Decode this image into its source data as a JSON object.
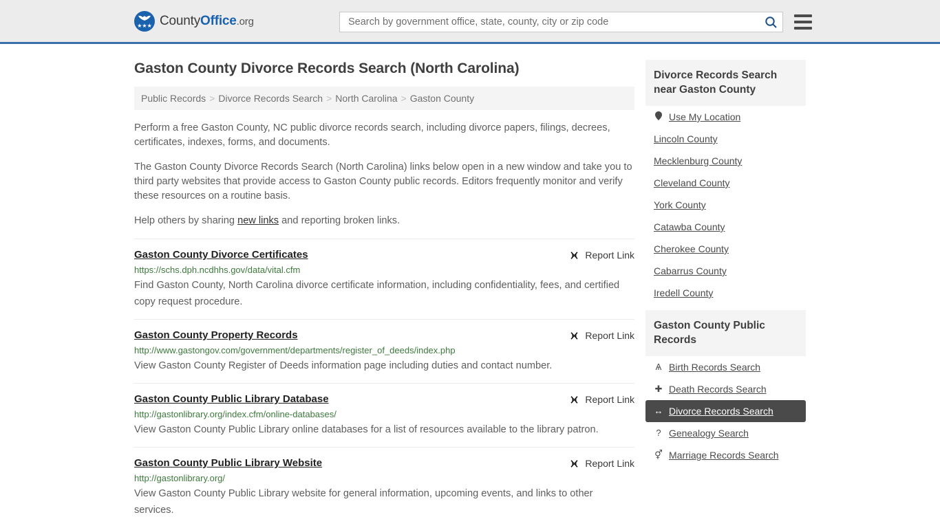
{
  "header": {
    "logo": {
      "part1": "County",
      "part2": "Office",
      "part3": ".org",
      "icon": "eagle-shield-logo",
      "stars": "★★★"
    },
    "search": {
      "placeholder": "Search by government office, state, county, city or zip code",
      "value": "",
      "search_icon": "search-icon"
    },
    "menu_icon": "hamburger-menu-icon",
    "accent_color": "#3a6fa8"
  },
  "main": {
    "title": "Gaston County Divorce Records Search (North Carolina)",
    "breadcrumb": [
      {
        "label": "Public Records"
      },
      {
        "label": "Divorce Records Search"
      },
      {
        "label": "North Carolina"
      },
      {
        "label": "Gaston County"
      }
    ],
    "breadcrumb_separator": ">",
    "intro": {
      "p1": "Perform a free Gaston County, NC public divorce records search, including divorce papers, filings, decrees, certificates, indexes, forms, and documents.",
      "p2": "The Gaston County Divorce Records Search (North Carolina) links below open in a new window and take you to third party websites that provide access to Gaston County public records. Editors frequently monitor and verify these resources on a routine basis.",
      "p3_before": "Help others by sharing ",
      "p3_link": "new links",
      "p3_after": " and reporting broken links."
    },
    "report_link_label": "Report Link",
    "report_link_icon": "broken-link-icon",
    "results": [
      {
        "title": "Gaston County Divorce Certificates",
        "url": "https://schs.dph.ncdhhs.gov/data/vital.cfm",
        "description": "Find Gaston County, North Carolina divorce certificate information, including confidentiality, fees, and certified copy request procedure."
      },
      {
        "title": "Gaston County Property Records",
        "url": "http://www.gastongov.com/government/departments/register_of_deeds/index.php",
        "description": "View Gaston County Register of Deeds information page including duties and contact number."
      },
      {
        "title": "Gaston County Public Library Database",
        "url": "http://gastonlibrary.org/index.cfm/online-databases/",
        "description": "View Gaston County Public Library online databases for a list of resources available to the library patron."
      },
      {
        "title": "Gaston County Public Library Website",
        "url": "http://gastonlibrary.org/",
        "description": "View Gaston County Public Library website for general information, upcoming events, and links to other services."
      }
    ]
  },
  "sidebar": {
    "nearby": {
      "heading": "Divorce Records Search near Gaston County",
      "items": [
        {
          "label": "Use My Location",
          "icon": "map-pin-icon",
          "active": false
        },
        {
          "label": "Lincoln County",
          "icon": "",
          "active": false
        },
        {
          "label": "Mecklenburg County",
          "icon": "",
          "active": false
        },
        {
          "label": "Cleveland County",
          "icon": "",
          "active": false
        },
        {
          "label": "York County",
          "icon": "",
          "active": false
        },
        {
          "label": "Catawba County",
          "icon": "",
          "active": false
        },
        {
          "label": "Cherokee County",
          "icon": "",
          "active": false
        },
        {
          "label": "Cabarrus County",
          "icon": "",
          "active": false
        },
        {
          "label": "Iredell County",
          "icon": "",
          "active": false
        }
      ]
    },
    "public_records": {
      "heading": "Gaston County Public Records",
      "items": [
        {
          "label": "Birth Records Search",
          "icon": "baby-icon",
          "glyph": "Ѧ",
          "active": false
        },
        {
          "label": "Death Records Search",
          "icon": "cross-icon",
          "glyph": "✚",
          "active": false
        },
        {
          "label": "Divorce Records Search",
          "icon": "left-right-arrow-icon",
          "glyph": "↔",
          "active": true
        },
        {
          "label": "Genealogy Search",
          "icon": "question-mark-icon",
          "glyph": "?",
          "active": false
        },
        {
          "label": "Marriage Records Search",
          "icon": "male-female-icon",
          "glyph": "⚥",
          "active": false
        }
      ]
    },
    "active_color": "#4a4a4a"
  }
}
